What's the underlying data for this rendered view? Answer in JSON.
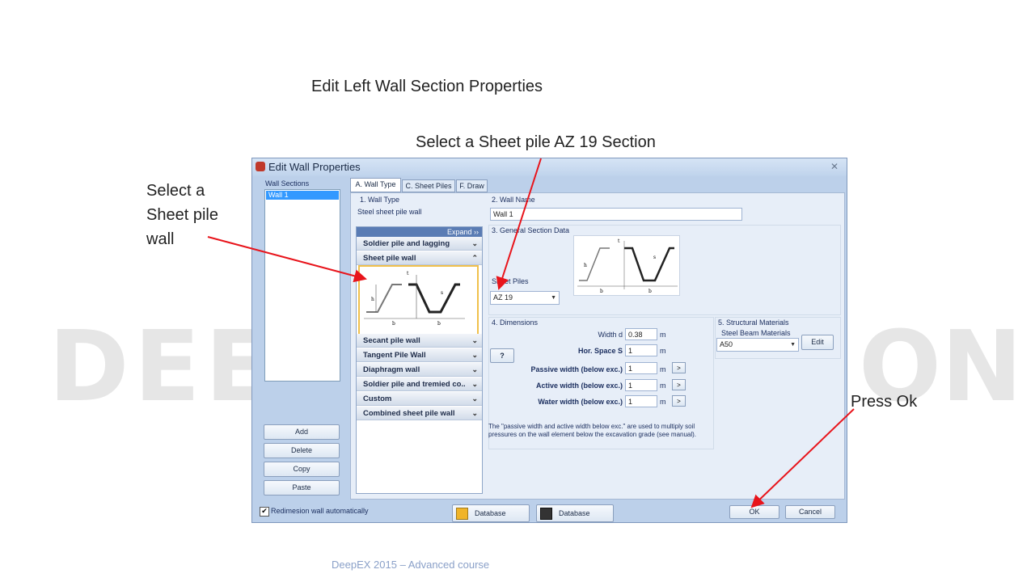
{
  "slide": {
    "title": "Edit Left Wall Section Properties",
    "annotation_top": "Select a Sheet pile AZ 19 Section",
    "annotation_left": [
      "Select a",
      "Sheet pile",
      "wall"
    ],
    "annotation_right": "Press Ok",
    "footer": "DeepEX 2015 – Advanced course",
    "watermark": "DEEP",
    "watermark_right": "ON",
    "arrow_color": "#e8141b"
  },
  "dialog": {
    "title": "Edit Wall Properties",
    "close_label": "✕",
    "wall_sections_label": "Wall Sections",
    "wall_sections": [
      "Wall 1"
    ],
    "buttons": [
      "Add",
      "Delete",
      "Copy",
      "Paste"
    ],
    "tabs": [
      "A. Wall Type",
      "C. Sheet Piles",
      "F. Draw"
    ],
    "wall_type": {
      "heading": "1. Wall Type",
      "value": "Steel sheet pile wall",
      "expand_label": "Expand ››",
      "categories": [
        {
          "label": "Soldier pile and lagging",
          "chevron": "⌄"
        },
        {
          "label": "Sheet pile wall",
          "chevron": "⌃"
        },
        {
          "label": "Secant pile wall",
          "chevron": "⌄"
        },
        {
          "label": "Tangent Pile Wall",
          "chevron": "⌄"
        },
        {
          "label": "Diaphragm wall",
          "chevron": "⌄"
        },
        {
          "label": "Soldier pile and tremied co..",
          "chevron": "⌄"
        },
        {
          "label": "Custom",
          "chevron": "⌄"
        },
        {
          "label": "Combined sheet pile wall",
          "chevron": "⌄"
        }
      ],
      "diagram_labels": {
        "h": "h",
        "t": "t",
        "s": "s",
        "b": "b"
      }
    },
    "wall_name": {
      "heading": "2. Wall Name",
      "value": "Wall 1"
    },
    "general_section": {
      "heading": "3. General Section Data",
      "sheet_piles_label": "Sheet Piles",
      "sheet_pile_value": "AZ 19"
    },
    "dimensions": {
      "heading": "4. Dimensions",
      "help_label": "?",
      "fields": [
        {
          "label": "Width d",
          "value": "0.38",
          "unit": "m"
        },
        {
          "label": "Hor. Space S",
          "value": "1",
          "unit": "m"
        },
        {
          "label": "Passive width (below exc.)",
          "value": "1",
          "unit": "m"
        },
        {
          "label": "Active width (below exc.)",
          "value": "1",
          "unit": "m"
        },
        {
          "label": "Water width (below exc.)",
          "value": "1",
          "unit": "m"
        }
      ],
      "arrow_label": ">",
      "note": "The \"passive width and active width below exc.\" are used to multiply soil pressures on the wall element below the excavation grade (see manual)."
    },
    "structural_materials": {
      "heading": "5. Structural Materials",
      "steel_label": "Steel Beam Materials",
      "steel_value": "A50",
      "edit_label": "Edit"
    },
    "bottom": {
      "checkbox_label": "Redimesion wall automatically",
      "checkbox_checked": "✔",
      "database_import": "Database",
      "database_save": "Database",
      "ok": "OK",
      "cancel": "Cancel"
    }
  }
}
